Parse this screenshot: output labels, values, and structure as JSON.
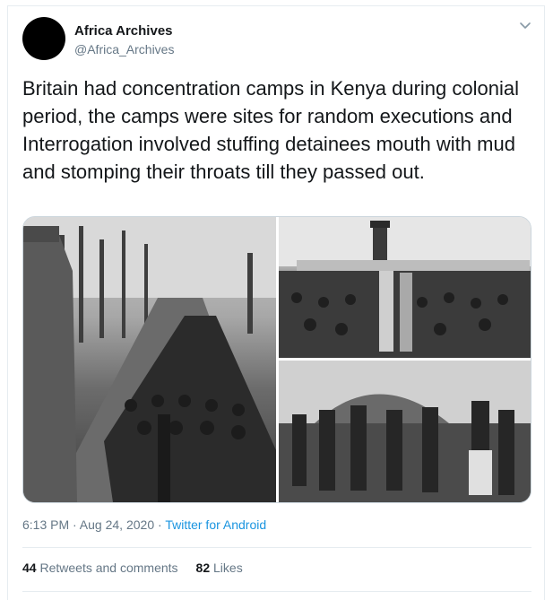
{
  "author": {
    "display_name": "Africa Archives",
    "handle": "@Africa_Archives"
  },
  "tweet": {
    "text": "Britain had concentration camps in Kenya during colonial period, the camps were sites for random executions and Interrogation involved stuffing detainees mouth with mud and stomping their throats till they passed out."
  },
  "meta": {
    "time": "6:13 PM · Aug 24, 2020",
    "separator": " · ",
    "source": "Twitter for Android"
  },
  "stats": {
    "retweets_count": "44",
    "retweets_label": "Retweets and comments",
    "likes_count": "82",
    "likes_label": "Likes"
  },
  "colors": {
    "link": "#1b95e0",
    "secondary_text": "#657786",
    "border": "#e6ecf0"
  }
}
